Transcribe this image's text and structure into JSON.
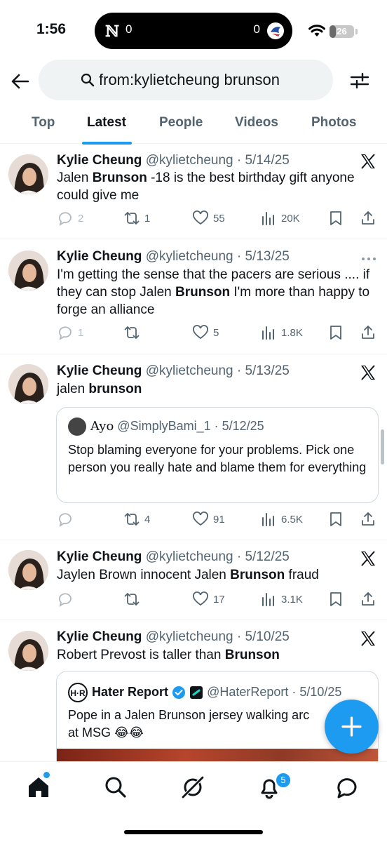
{
  "status": {
    "time": "1:56",
    "score_left": "0",
    "score_right": "0",
    "battery": "26",
    "battery_level": 0.26
  },
  "search": {
    "query": "from:kylietcheung brunson",
    "placeholder": "Search"
  },
  "tabs": [
    {
      "label": "Top"
    },
    {
      "label": "Latest"
    },
    {
      "label": "People"
    },
    {
      "label": "Videos"
    },
    {
      "label": "Photos"
    }
  ],
  "tweets": [
    {
      "name": "Kylie Cheung",
      "meta": "@kylietcheung · 5/14/25",
      "text": [
        {
          "t": "Jalen "
        },
        {
          "b": "Brunson"
        },
        {
          "t": " -18 is the best birthday gift anyone could give me"
        }
      ],
      "replies": "2",
      "retweets": "1",
      "likes": "55",
      "views": "20K"
    },
    {
      "name": "Kylie Cheung",
      "meta": "@kylietcheung · 5/13/25",
      "text_a": "I'm getting the sense that the pacers are serious .... if they can stop Jalen ",
      "text_b": "Brunson",
      "text_c": " I'm more than happy to forge an alliance",
      "replies": "1",
      "retweets": "",
      "likes": "5",
      "views": "1.8K"
    },
    {
      "name": "Kylie Cheung",
      "meta": "@kylietcheung · 5/13/25",
      "text_a": "jalen ",
      "text_b": "brunson",
      "quote": {
        "name": "Ayo",
        "meta": "@SimplyBami_1 · 5/12/25",
        "text": "Stop blaming everyone for your problems. Pick one person you really hate and blame them for everything"
      },
      "replies": "",
      "retweets": "4",
      "likes": "91",
      "views": "6.5K"
    },
    {
      "name": "Kylie Cheung",
      "meta": "@kylietcheung · 5/12/25",
      "text_a": "Jaylen Brown innocent Jalen ",
      "text_b": "Brunson",
      "text_c": " fraud",
      "replies": "",
      "retweets": "",
      "likes": "17",
      "views": "3.1K"
    },
    {
      "name": "Kylie Cheung",
      "meta": "@kylietcheung · 5/10/25",
      "text_a": "Robert Prevost is taller than ",
      "text_b": "Brunson",
      "quote": {
        "name": "Hater Report",
        "meta": "@HaterReport · 5/10/25",
        "text": "Pope in a Jalen Brunson jersey walking arc",
        "text2": "at MSG 😂😂"
      }
    }
  ],
  "nav": {
    "notifications_badge": "5"
  },
  "colors": {
    "accent": "#1d9bf0",
    "text": "#0f1419",
    "muted": "#536471"
  }
}
